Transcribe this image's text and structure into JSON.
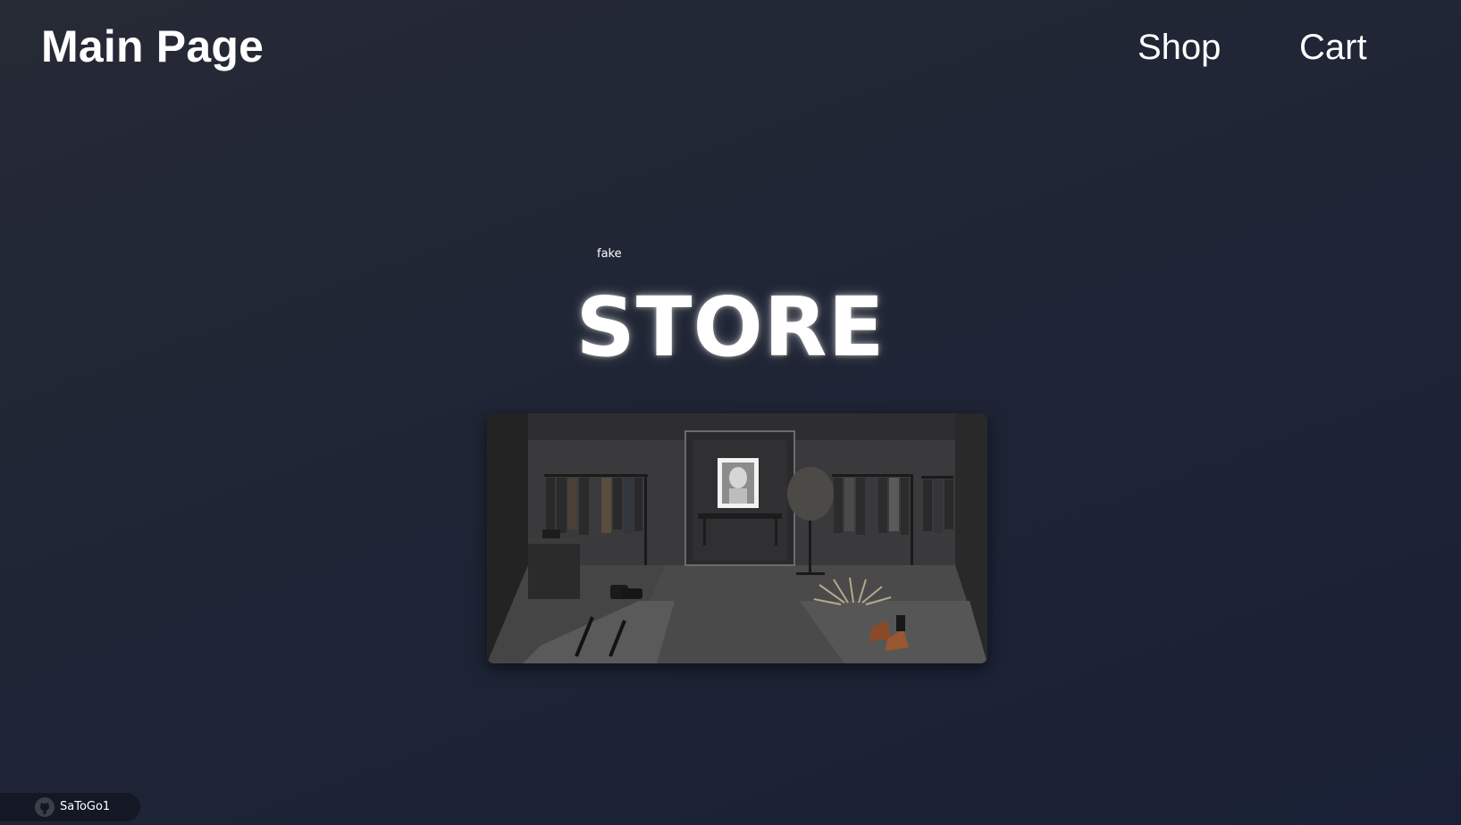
{
  "header": {
    "title": "Main Page",
    "nav": [
      {
        "label": "Shop"
      },
      {
        "label": "Cart"
      }
    ]
  },
  "hero": {
    "kicker": "fake",
    "title": "STORE",
    "image": {
      "subject": "dark clothing store interior"
    }
  },
  "badge": {
    "icon": "github-icon",
    "label": "SaToGo1"
  },
  "colors": {
    "background_top": "#262a35",
    "background_bottom": "#1a2136",
    "text": "#ffffff",
    "badge_bg": "#141824"
  }
}
